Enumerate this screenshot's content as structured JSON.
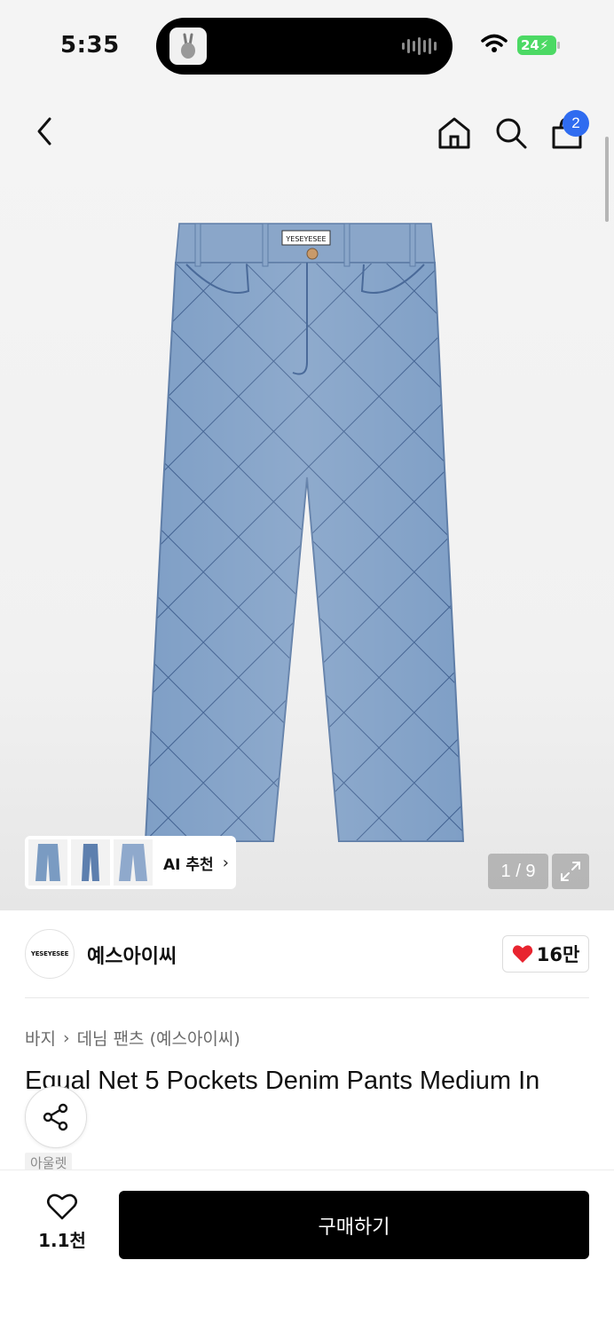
{
  "status_bar": {
    "time": "5:35",
    "battery": "24"
  },
  "header": {
    "cart_count": "2"
  },
  "gallery": {
    "ai_label": "AI 추천",
    "counter": "1 / 9",
    "jeans_label": "YESEYESEE"
  },
  "brand": {
    "logo_text": "YESEYESEE",
    "name": "예스아이씨",
    "likes": "16만",
    "like_color": "#e8242f"
  },
  "breadcrumb": {
    "level1": "바지",
    "level2": "데님 팬츠 (예스아이씨)"
  },
  "product": {
    "title": "Equal Net 5 Pockets Denim Pants Medium In",
    "tag": "아울렛"
  },
  "bottom_bar": {
    "wishlist_count": "1.1천",
    "buy_label": "구매하기"
  },
  "colors": {
    "accent_badge": "#2f6cf0",
    "buy_bg": "#000000",
    "denim": "#7a9bc2"
  }
}
